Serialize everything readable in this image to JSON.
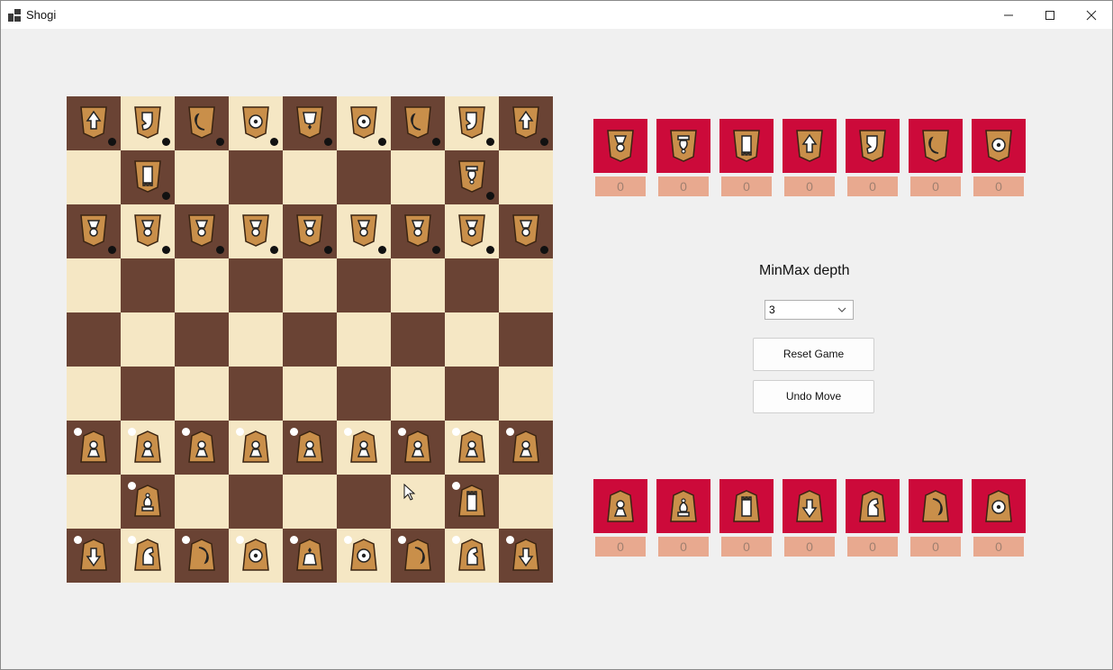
{
  "window": {
    "title": "Shogi"
  },
  "controls": {
    "depth_label": "MinMax depth",
    "depth_value": "3",
    "reset_label": "Reset Game",
    "undo_label": "Undo Move"
  },
  "colors": {
    "light_square": "#f5e7c4",
    "dark_square": "#6a4334",
    "tray_tile": "#cc0a3a",
    "tray_count_bg": "#e8a98f",
    "piece_wood": "#c98f4a"
  },
  "board": {
    "rows": [
      [
        {
          "p": "lance",
          "s": "enemy"
        },
        {
          "p": "knight",
          "s": "enemy"
        },
        {
          "p": "silver",
          "s": "enemy"
        },
        {
          "p": "gold",
          "s": "enemy"
        },
        {
          "p": "king",
          "s": "enemy"
        },
        {
          "p": "gold",
          "s": "enemy"
        },
        {
          "p": "silver",
          "s": "enemy"
        },
        {
          "p": "knight",
          "s": "enemy"
        },
        {
          "p": "lance",
          "s": "enemy"
        }
      ],
      [
        null,
        {
          "p": "rook",
          "s": "enemy"
        },
        null,
        null,
        null,
        null,
        null,
        {
          "p": "bishop",
          "s": "enemy"
        },
        null
      ],
      [
        {
          "p": "pawn",
          "s": "enemy"
        },
        {
          "p": "pawn",
          "s": "enemy"
        },
        {
          "p": "pawn",
          "s": "enemy"
        },
        {
          "p": "pawn",
          "s": "enemy"
        },
        {
          "p": "pawn",
          "s": "enemy"
        },
        {
          "p": "pawn",
          "s": "enemy"
        },
        {
          "p": "pawn",
          "s": "enemy"
        },
        {
          "p": "pawn",
          "s": "enemy"
        },
        {
          "p": "pawn",
          "s": "enemy"
        }
      ],
      [
        null,
        null,
        null,
        null,
        null,
        null,
        null,
        null,
        null
      ],
      [
        null,
        null,
        null,
        null,
        null,
        null,
        null,
        null,
        null
      ],
      [
        null,
        null,
        null,
        null,
        null,
        null,
        null,
        null,
        null
      ],
      [
        {
          "p": "pawn",
          "s": "player"
        },
        {
          "p": "pawn",
          "s": "player"
        },
        {
          "p": "pawn",
          "s": "player"
        },
        {
          "p": "pawn",
          "s": "player"
        },
        {
          "p": "pawn",
          "s": "player"
        },
        {
          "p": "pawn",
          "s": "player"
        },
        {
          "p": "pawn",
          "s": "player"
        },
        {
          "p": "pawn",
          "s": "player"
        },
        {
          "p": "pawn",
          "s": "player"
        }
      ],
      [
        null,
        {
          "p": "bishop",
          "s": "player"
        },
        null,
        null,
        null,
        null,
        null,
        {
          "p": "rook",
          "s": "player"
        },
        null
      ],
      [
        {
          "p": "lance",
          "s": "player"
        },
        {
          "p": "knight",
          "s": "player"
        },
        {
          "p": "silver",
          "s": "player"
        },
        {
          "p": "gold",
          "s": "player"
        },
        {
          "p": "king",
          "s": "player"
        },
        {
          "p": "gold",
          "s": "player"
        },
        {
          "p": "silver",
          "s": "player"
        },
        {
          "p": "knight",
          "s": "player"
        },
        {
          "p": "lance",
          "s": "player"
        }
      ]
    ]
  },
  "enemy_hand": [
    {
      "piece": "pawn",
      "count": "0"
    },
    {
      "piece": "bishop",
      "count": "0"
    },
    {
      "piece": "rook",
      "count": "0"
    },
    {
      "piece": "lance",
      "count": "0"
    },
    {
      "piece": "knight",
      "count": "0"
    },
    {
      "piece": "silver",
      "count": "0"
    },
    {
      "piece": "gold",
      "count": "0"
    }
  ],
  "player_hand": [
    {
      "piece": "pawn",
      "count": "0"
    },
    {
      "piece": "bishop",
      "count": "0"
    },
    {
      "piece": "rook",
      "count": "0"
    },
    {
      "piece": "lance",
      "count": "0"
    },
    {
      "piece": "knight",
      "count": "0"
    },
    {
      "piece": "silver",
      "count": "0"
    },
    {
      "piece": "gold",
      "count": "0"
    }
  ]
}
